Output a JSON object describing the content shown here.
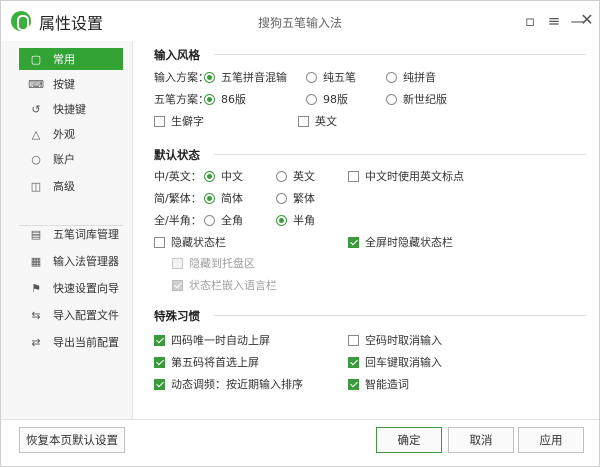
{
  "title": {
    "app_title": "属性设置",
    "subtitle": "搜狗五笔输入法"
  },
  "icons": {
    "feedback": "feedback-icon",
    "skin": "skin-icon",
    "minimize": "minimize-icon",
    "close": "close-icon"
  },
  "sidebar": {
    "items": [
      {
        "label": "常用",
        "icon": "monitor-icon",
        "active": true
      },
      {
        "label": "按键",
        "icon": "keyboard-icon"
      },
      {
        "label": "快捷键",
        "icon": "shortcut-icon"
      },
      {
        "label": "外观",
        "icon": "shirt-icon"
      },
      {
        "label": "账户",
        "icon": "user-icon"
      },
      {
        "label": "高级",
        "icon": "chip-icon"
      }
    ],
    "tools": [
      {
        "label": "五笔词库管理",
        "icon": "dictionary-icon"
      },
      {
        "label": "输入法管理器",
        "icon": "keyboard-manager-icon"
      },
      {
        "label": "快速设置向导",
        "icon": "flag-icon"
      },
      {
        "label": "导入配置文件",
        "icon": "import-icon"
      },
      {
        "label": "导出当前配置",
        "icon": "export-icon"
      }
    ]
  },
  "input_style": {
    "title": "输入风格",
    "scheme_label": "输入方案：",
    "scheme_options": [
      "五笔拼音混输",
      "纯五笔",
      "纯拼音"
    ],
    "wubi_label": "五笔方案：",
    "wubi_options": [
      "86版",
      "98版",
      "新世纪版"
    ],
    "rare_chars": "生僻字",
    "english": "英文"
  },
  "default_state": {
    "title": "默认状态",
    "lang_label": "中/英文：",
    "lang_options": [
      "中文",
      "英文"
    ],
    "lang_punct": "中文时使用英文标点",
    "script_label": "简/繁体：",
    "script_options": [
      "简体",
      "繁体"
    ],
    "width_label": "全/半角：",
    "width_options": [
      "全角",
      "半角"
    ],
    "hide_status": "隐藏状态栏",
    "fullscreen_hide": "全屏时隐藏状态栏",
    "hide_to_tray": "隐藏到托盘区",
    "embed_lang_bar": "状态栏嵌入语言栏"
  },
  "special_habits": {
    "title": "特殊习惯",
    "items": [
      "四码唯一时自动上屏",
      "空码时取消输入",
      "第五码将首选上屏",
      "回车键取消输入",
      "动态调频：按近期输入排序",
      "智能造词"
    ]
  },
  "footer": {
    "restore": "恢复本页默认设置",
    "ok": "确定",
    "cancel": "取消",
    "apply": "应用"
  },
  "colors": {
    "accent": "#33a336"
  }
}
